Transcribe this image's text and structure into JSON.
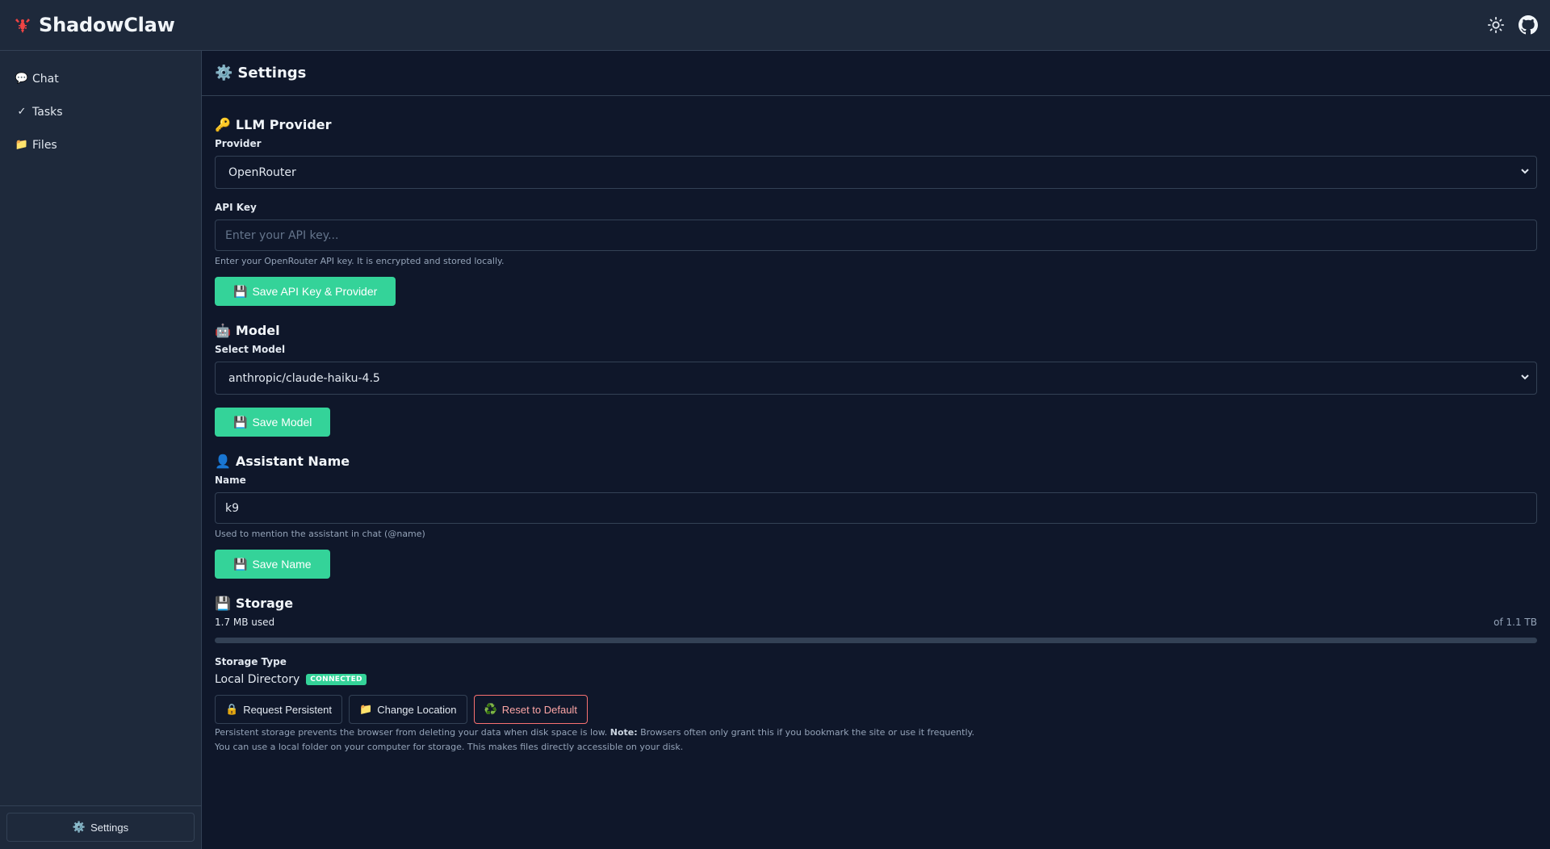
{
  "app": {
    "title": "ShadowClaw"
  },
  "header": {
    "theme_icon": "sun-icon",
    "repo_icon": "github-icon"
  },
  "sidebar": {
    "items": [
      {
        "glyph": "💬",
        "label": "Chat",
        "icon": "chat-bubble-icon"
      },
      {
        "glyph": "✓",
        "label": "Tasks",
        "icon": "checkmark-icon"
      },
      {
        "glyph": "📁",
        "label": "Files",
        "icon": "folder-icon"
      }
    ],
    "footer": {
      "glyph": "⚙️",
      "label": "Settings"
    }
  },
  "page": {
    "glyph": "⚙️",
    "title": "Settings"
  },
  "llm_provider": {
    "glyph": "🔑",
    "title": "LLM Provider",
    "provider_label": "Provider",
    "provider_value": "OpenRouter",
    "api_key_label": "API Key",
    "api_key_placeholder": "Enter your API key...",
    "api_key_value": "",
    "api_key_hint": "Enter your OpenRouter API key. It is encrypted and stored locally.",
    "save_glyph": "💾",
    "save_label": "Save API Key & Provider"
  },
  "model": {
    "glyph": "🤖",
    "title": "Model",
    "select_label": "Select Model",
    "select_value": "anthropic/claude-haiku-4.5",
    "save_glyph": "💾",
    "save_label": "Save Model"
  },
  "assistant": {
    "glyph": "👤",
    "title": "Assistant Name",
    "name_label": "Name",
    "name_value": "k9",
    "name_hint": "Used to mention the assistant in chat (@name)",
    "save_glyph": "💾",
    "save_label": "Save Name"
  },
  "storage": {
    "glyph": "💾",
    "title": "Storage",
    "used": "1.7 MB used",
    "total": "of 1.1 TB",
    "usage_fraction": 1.5e-06,
    "type_label": "Storage Type",
    "type_value": "Local Directory",
    "status_badge": "CONNECTED",
    "buttons": {
      "persistent_glyph": "🔒",
      "persistent": "Request Persistent",
      "change_glyph": "📁",
      "change": "Change Location",
      "reset_glyph": "♻️",
      "reset": "Reset to Default"
    },
    "note_1_text": "Persistent storage prevents the browser from deleting your data when disk space is low. ",
    "note_1_bold": "Note:",
    "note_1_tail": " Browsers often only grant this if you bookmark the site or use it frequently.",
    "note_2": "You can use a local folder on your computer for storage. This makes files directly accessible on your disk."
  },
  "colors": {
    "background": "#0f172a",
    "panel": "#1e293b",
    "border": "#334155",
    "accent": "#34d399",
    "danger": "#f87171",
    "brand": "#ef4444"
  }
}
